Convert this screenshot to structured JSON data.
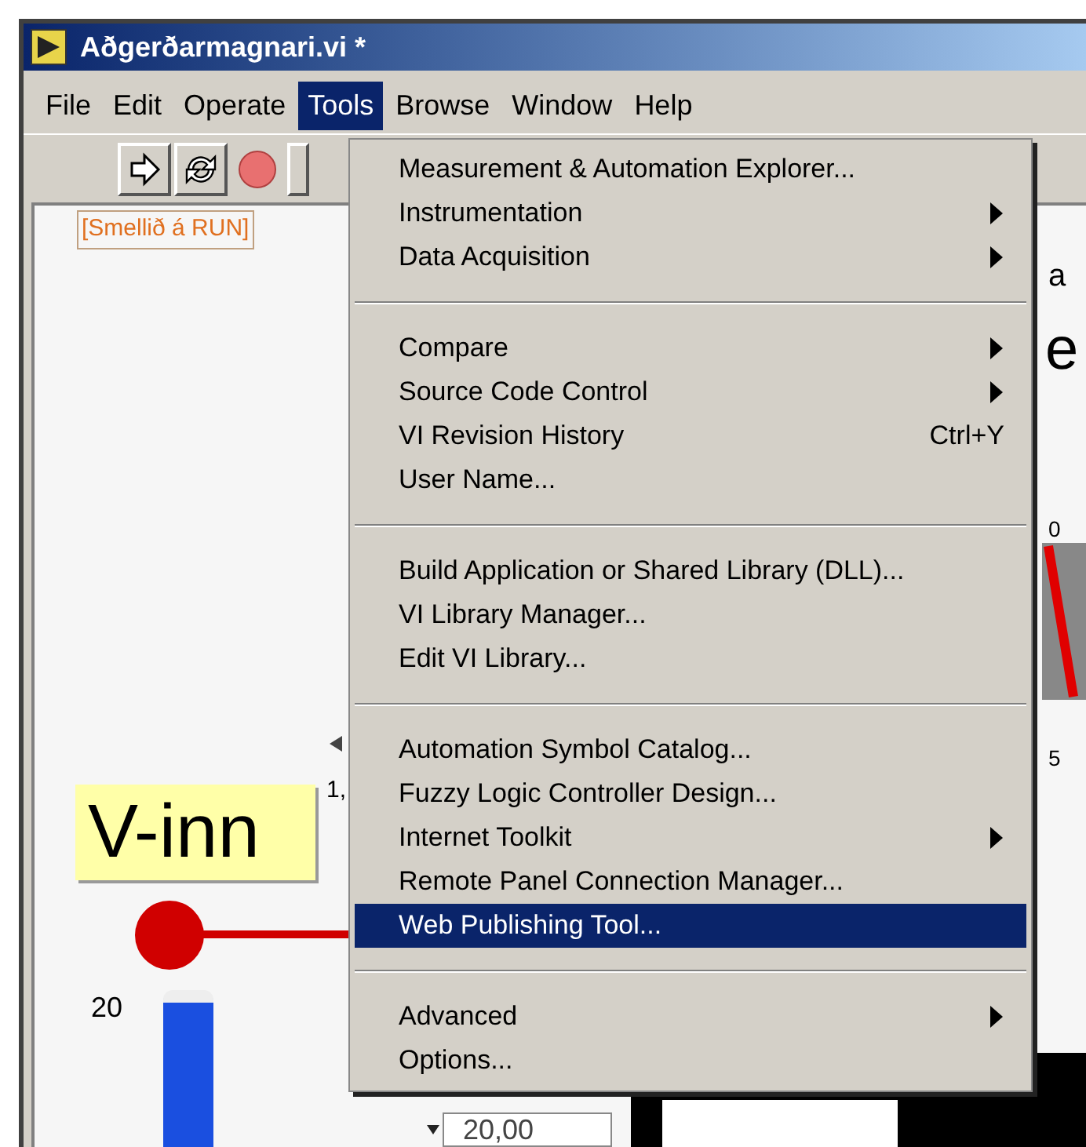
{
  "window": {
    "title": "Aðgerðarmagnari.vi *"
  },
  "menu_bar": [
    {
      "label": "File",
      "selected": false
    },
    {
      "label": "Edit",
      "selected": false
    },
    {
      "label": "Operate",
      "selected": false
    },
    {
      "label": "Tools",
      "selected": true
    },
    {
      "label": "Browse",
      "selected": false
    },
    {
      "label": "Window",
      "selected": false
    },
    {
      "label": "Help",
      "selected": false
    }
  ],
  "tools_menu": {
    "groups": [
      [
        {
          "label": "Measurement & Automation Explorer...",
          "submenu": false,
          "selected": false
        },
        {
          "label": "Instrumentation",
          "submenu": true,
          "selected": false
        },
        {
          "label": "Data Acquisition",
          "submenu": true,
          "selected": false
        }
      ],
      [
        {
          "label": "Compare",
          "submenu": true,
          "selected": false
        },
        {
          "label": "Source Code Control",
          "submenu": true,
          "selected": false
        },
        {
          "label": "VI Revision History",
          "shortcut": "Ctrl+Y",
          "submenu": false,
          "selected": false
        },
        {
          "label": "User Name...",
          "submenu": false,
          "selected": false
        }
      ],
      [
        {
          "label": "Build Application or Shared Library (DLL)...",
          "submenu": false,
          "selected": false
        },
        {
          "label": "VI Library Manager...",
          "submenu": false,
          "selected": false
        },
        {
          "label": "Edit VI Library...",
          "submenu": false,
          "selected": false
        }
      ],
      [
        {
          "label": "Automation Symbol Catalog...",
          "submenu": false,
          "selected": false
        },
        {
          "label": "Fuzzy Logic Controller Design...",
          "submenu": false,
          "selected": false
        },
        {
          "label": "Internet Toolkit",
          "submenu": true,
          "selected": false
        },
        {
          "label": "Remote Panel Connection Manager...",
          "submenu": false,
          "selected": false
        },
        {
          "label": "Web Publishing Tool...",
          "submenu": false,
          "selected": true
        }
      ],
      [
        {
          "label": "Advanced",
          "submenu": true,
          "selected": false
        },
        {
          "label": "Options...",
          "submenu": false,
          "selected": false
        }
      ]
    ]
  },
  "front_panel": {
    "free_label": "[Smellið á RUN]",
    "control_label": "V-inn",
    "scale_tick": "20",
    "numeric_value": "20,00",
    "fragments": [
      "a",
      "e",
      "0",
      "5",
      "1,"
    ]
  }
}
